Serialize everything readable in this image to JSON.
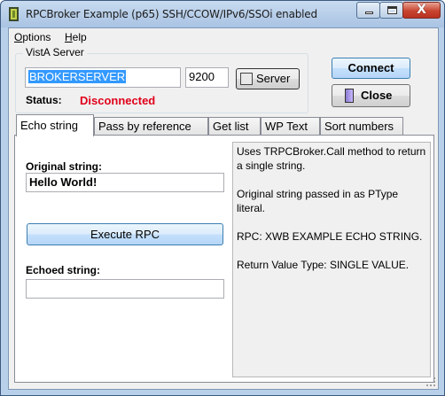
{
  "window": {
    "title": "RPCBroker Example (p65) SSH/CCOW/IPv6/SSOi enabled",
    "close_glyph": "X"
  },
  "menu": {
    "options": {
      "label": "Options",
      "mnemonic": "O",
      "rest": "ptions"
    },
    "help": {
      "label": "Help",
      "mnemonic": "H",
      "rest": "elp"
    }
  },
  "server_group": {
    "legend": "VistA Server",
    "server_value": "BROKERSERVER",
    "port_value": "9200",
    "server_button": "Server",
    "status_label": "Status:",
    "status_value": "Disconnected"
  },
  "buttons": {
    "connect": "Connect",
    "close": "Close"
  },
  "tabs": [
    {
      "label": "Echo string",
      "active": true
    },
    {
      "label": "Pass by reference",
      "active": false
    },
    {
      "label": "Get list",
      "active": false
    },
    {
      "label": "WP Text",
      "active": false
    },
    {
      "label": "Sort numbers",
      "active": false
    }
  ],
  "echo_tab": {
    "original_label": "Original string:",
    "original_value": "Hello World!",
    "execute_button": "Execute RPC",
    "echoed_label": "Echoed string:",
    "echoed_value": "",
    "info_paragraphs": [
      "Uses TRPCBroker.Call method to return a single string.",
      "Original string passed in as PType literal.",
      "RPC: XWB EXAMPLE ECHO STRING.",
      "Return Value Type: SINGLE VALUE."
    ]
  },
  "colors": {
    "status_disconnected": "#e0001a",
    "selection": "#3399ff"
  },
  "icons": [
    "app-icon",
    "server-icon",
    "door-icon",
    "minimize-icon",
    "maximize-icon",
    "close-icon",
    "size-grip-icon"
  ]
}
